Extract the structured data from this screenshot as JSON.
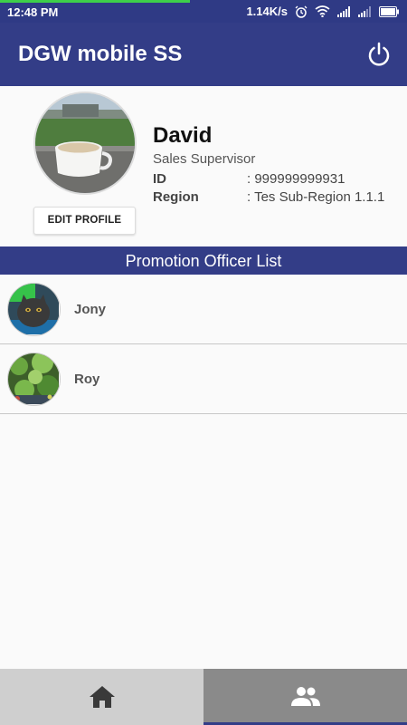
{
  "status_bar": {
    "time": "12:48 PM",
    "speed": "1.14K/s",
    "icons": [
      "alarm-icon",
      "wifi-icon",
      "signal-icon",
      "signal-icon",
      "battery-icon"
    ]
  },
  "app_bar": {
    "title": "DGW mobile SS",
    "power_icon": "power-icon"
  },
  "profile": {
    "name": "David",
    "role": "Sales Supervisor",
    "id_label": "ID",
    "id_value": ": 999999999931",
    "region_label": "Region",
    "region_value": ": Tes Sub-Region 1.1.1",
    "edit_button": "EDIT PROFILE"
  },
  "section": {
    "title": "Promotion Officer List"
  },
  "officers": [
    {
      "name": "Jony"
    },
    {
      "name": "Roy"
    }
  ],
  "bottom_nav": {
    "items": [
      {
        "icon": "home-icon",
        "selected": false
      },
      {
        "icon": "people-icon",
        "selected": true
      }
    ]
  },
  "colors": {
    "primary": "#333d87",
    "progress": "#3ecf4a",
    "nav_inactive": "#cfcfcf",
    "nav_active": "#8a8a8a"
  }
}
